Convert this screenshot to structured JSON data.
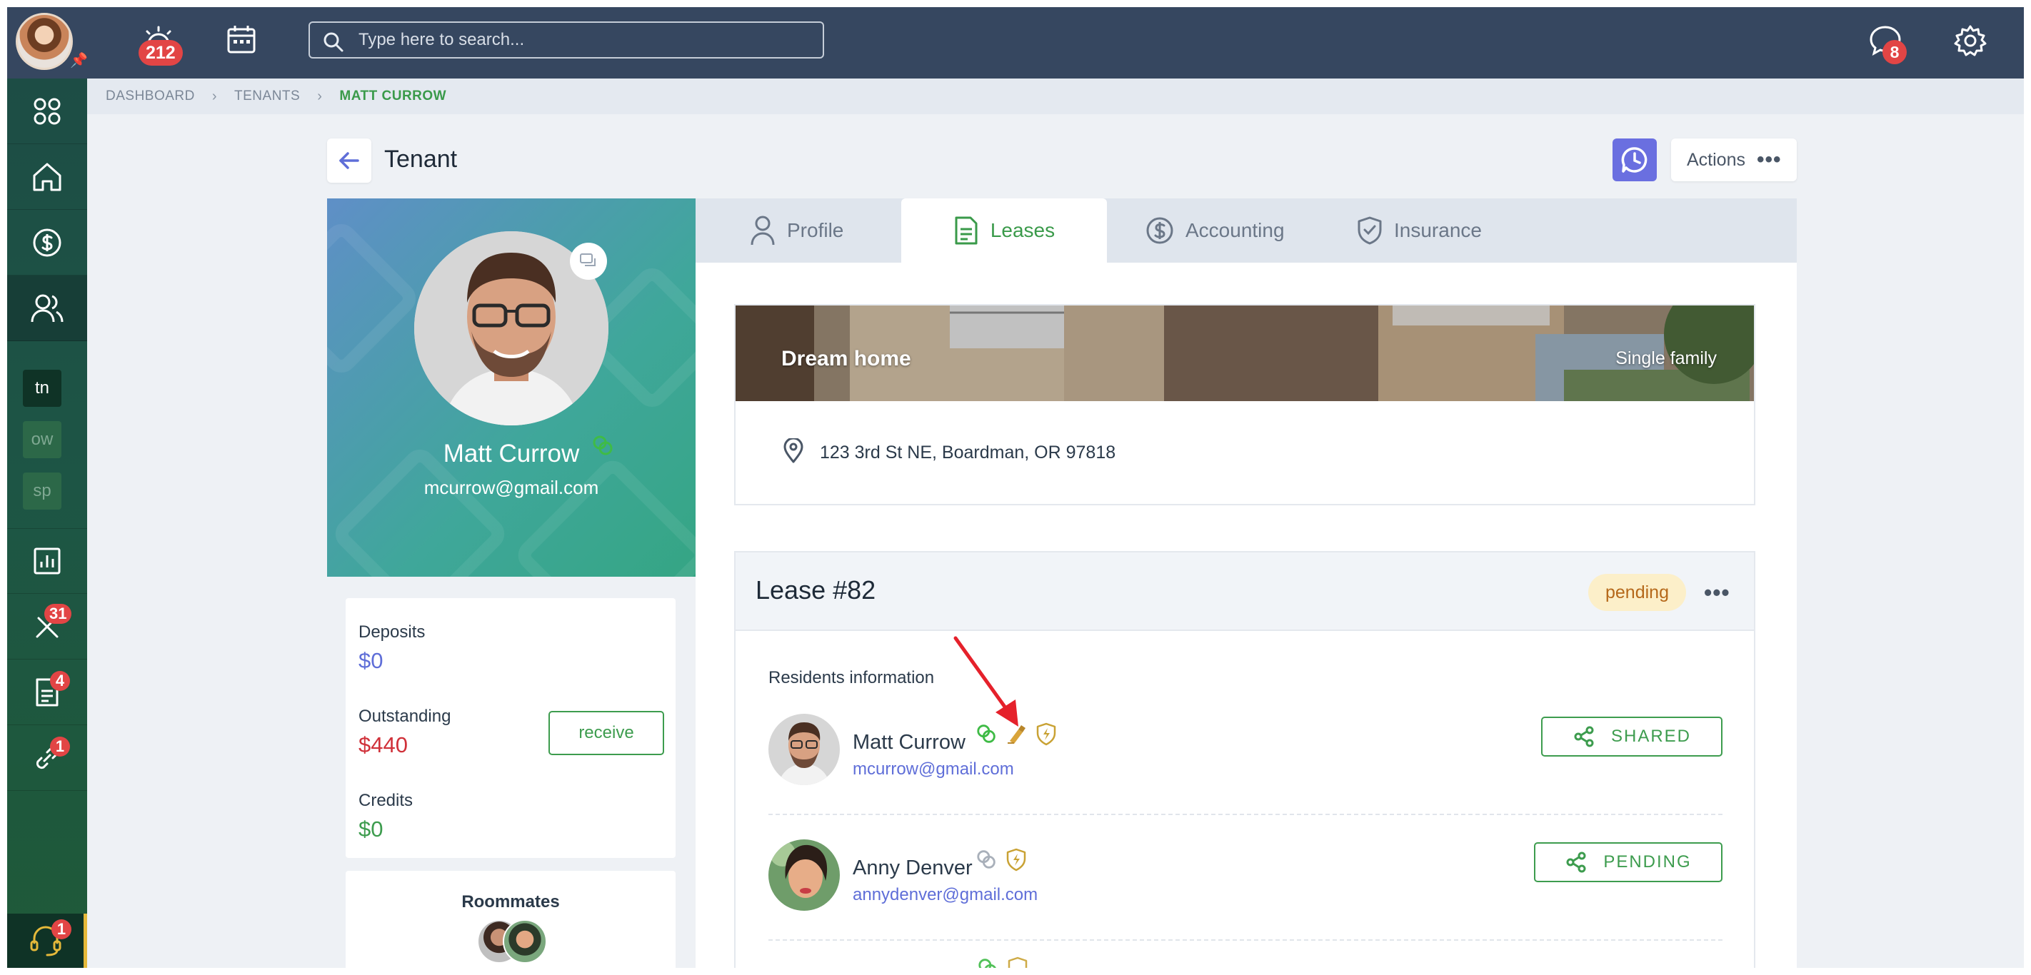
{
  "topbar": {
    "notifications_count": "212",
    "search_placeholder": "Type here to search...",
    "messages_count": "8"
  },
  "sidebar": {
    "workspaces": [
      "tn",
      "ow",
      "sp"
    ],
    "maintenance_count": "31",
    "documents_count": "4",
    "links_count": "1",
    "support_count": "1"
  },
  "breadcrumb": [
    "DASHBOARD",
    "TENANTS",
    "MATT CURROW"
  ],
  "header": {
    "title": "Tenant",
    "actions_label": "Actions"
  },
  "tenant": {
    "name": "Matt Currow",
    "email": "mcurrow@gmail.com"
  },
  "balances": {
    "deposits_label": "Deposits",
    "deposits_value": "$0",
    "outstanding_label": "Outstanding",
    "outstanding_value": "$440",
    "credits_label": "Credits",
    "credits_value": "$0",
    "receive_label": "receive"
  },
  "roommates": {
    "title": "Roommates"
  },
  "tabs": [
    {
      "label": "Profile",
      "icon": "user-icon"
    },
    {
      "label": "Leases",
      "icon": "document-icon"
    },
    {
      "label": "Accounting",
      "icon": "dollar-circle-icon"
    },
    {
      "label": "Insurance",
      "icon": "shield-icon"
    }
  ],
  "active_tab": "Leases",
  "property": {
    "name": "Dream home",
    "type": "Single family",
    "address": "123 3rd St NE, Boardman, OR 97818"
  },
  "lease": {
    "title": "Lease #82",
    "status": "pending",
    "residents_title": "Residents information",
    "residents": [
      {
        "name": "Matt Currow",
        "email": "mcurrow@gmail.com",
        "share_label": "SHARED"
      },
      {
        "name": "Anny Denver",
        "email": "annydenver@gmail.com",
        "share_label": "PENDING"
      }
    ]
  },
  "colors": {
    "topbar": "#364760",
    "accent_green": "#3d9c4e",
    "outstanding_red": "#d0313a",
    "deposit_blue": "#5f6ed8",
    "pending_badge": "#fcefc9",
    "badge_red": "#e24545"
  }
}
